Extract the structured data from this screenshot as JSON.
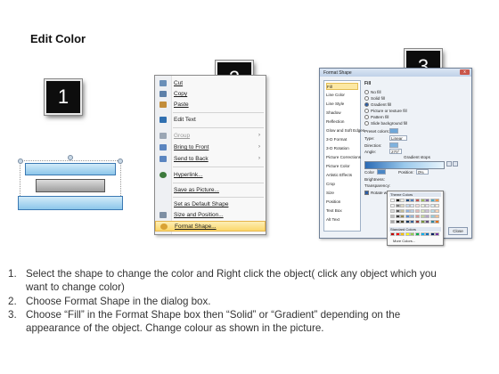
{
  "title": "Edit Color",
  "badges": [
    "1",
    "2",
    "3"
  ],
  "context_menu": {
    "items": [
      {
        "label": "Cut",
        "icon": "scissors-icon",
        "color": "#6a8fb8"
      },
      {
        "label": "Copy",
        "icon": "copy-icon",
        "color": "#5b7fa8"
      },
      {
        "label": "Paste",
        "icon": "paste-icon",
        "color": "#c28d3b"
      },
      {
        "label": "Edit Text",
        "icon": "edit-text-icon",
        "color": "#2f6fb0"
      },
      {
        "label": "Group",
        "icon": "group-icon",
        "color": "#9aa6b4",
        "disabled": true,
        "submenu": true
      },
      {
        "label": "Bring to Front",
        "icon": "bring-to-front-icon",
        "color": "#5a85c0",
        "submenu": true
      },
      {
        "label": "Send to Back",
        "icon": "send-to-back-icon",
        "color": "#5a85c0",
        "submenu": true
      },
      {
        "label": "Hyperlink...",
        "icon": "hyperlink-icon",
        "color": "#3c7a3c"
      },
      {
        "label": "Save as Picture...",
        "icon": "",
        "color": ""
      },
      {
        "label": "Set as Default Shape",
        "icon": "",
        "color": ""
      },
      {
        "label": "Size and Position...",
        "icon": "size-position-icon",
        "color": "#7d8fa3"
      },
      {
        "label": "Format Shape...",
        "icon": "format-shape-icon",
        "color": "#d9a234",
        "highlighted": true
      }
    ]
  },
  "dialog": {
    "title": "Format Shape",
    "close_glyph": "x",
    "categories": [
      "Fill",
      "Line Color",
      "Line Style",
      "Shadow",
      "Reflection",
      "Glow and Soft Edges",
      "3-D Format",
      "3-D Rotation",
      "Picture Corrections",
      "Picture Color",
      "Artistic Effects",
      "Crop",
      "Size",
      "Position",
      "Text Box",
      "Alt Text"
    ],
    "fill_heading": "Fill",
    "fill_options": [
      {
        "label": "No fill",
        "selected": false
      },
      {
        "label": "Solid fill",
        "selected": false
      },
      {
        "label": "Gradient fill",
        "selected": true
      },
      {
        "label": "Picture or texture fill",
        "selected": false
      },
      {
        "label": "Pattern fill",
        "selected": false
      },
      {
        "label": "Slide background fill",
        "selected": false
      }
    ],
    "preset_colors_label": "Preset colors:",
    "type_label": "Type:",
    "type_value": "Linear",
    "direction_label": "Direction:",
    "angle_label": "Angle:",
    "angle_value": "270°",
    "gradient_stops_label": "Gradient stops",
    "color_label": "Color",
    "position_label": "Position:",
    "position_value": "0%",
    "brightness_label": "Brightness:",
    "transparency_label": "Transparency:",
    "rotate_label": "Rotate with shape",
    "close_label": "Close"
  },
  "palette": {
    "theme_colors_label": "Theme Colors",
    "standard_colors_label": "Standard Colors",
    "more_colors_label": "More Colors...",
    "theme_rows": [
      [
        "#ffffff",
        "#000000",
        "#eeece1",
        "#1f497d",
        "#4f81bd",
        "#c0504d",
        "#9bbb59",
        "#8064a2",
        "#4bacc6",
        "#f79646"
      ],
      [
        "#f2f2f2",
        "#7f7f7f",
        "#ddd9c3",
        "#c6d9f0",
        "#dbe5f1",
        "#f2dcdb",
        "#ebf1dd",
        "#e5e0ec",
        "#dbeef3",
        "#fdeada"
      ],
      [
        "#d8d8d8",
        "#595959",
        "#c4bd97",
        "#8db3e2",
        "#b8cce4",
        "#e5b9b7",
        "#d7e3bc",
        "#ccc1d9",
        "#b7dde8",
        "#fbd5b5"
      ],
      [
        "#bfbfbf",
        "#3f3f3f",
        "#938953",
        "#548dd4",
        "#95b3d7",
        "#d99694",
        "#c3d69b",
        "#b2a2c7",
        "#92cddc",
        "#fac08f"
      ],
      [
        "#a5a5a5",
        "#262626",
        "#494429",
        "#17365d",
        "#366092",
        "#953734",
        "#76923c",
        "#5f497a",
        "#31859b",
        "#e36c09"
      ]
    ],
    "standard_row": [
      "#c00000",
      "#ff0000",
      "#ffc000",
      "#ffff00",
      "#92d050",
      "#00b050",
      "#00b0f0",
      "#0070c0",
      "#002060",
      "#7030a0"
    ]
  },
  "steps": [
    {
      "num": "1.",
      "line1": "Select the shape to change the color and Right click the object( click any object which you",
      "line2": "want to change color)"
    },
    {
      "num": "2.",
      "line1": "Choose Format Shape in the dialog box.",
      "line2": ""
    },
    {
      "num": "3.",
      "line1": "Choose “Fill” in the Format Shape box then “Solid” or “Gradient” depending on the",
      "line2": "appearance of the object. Change colour as shown in the picture."
    }
  ]
}
